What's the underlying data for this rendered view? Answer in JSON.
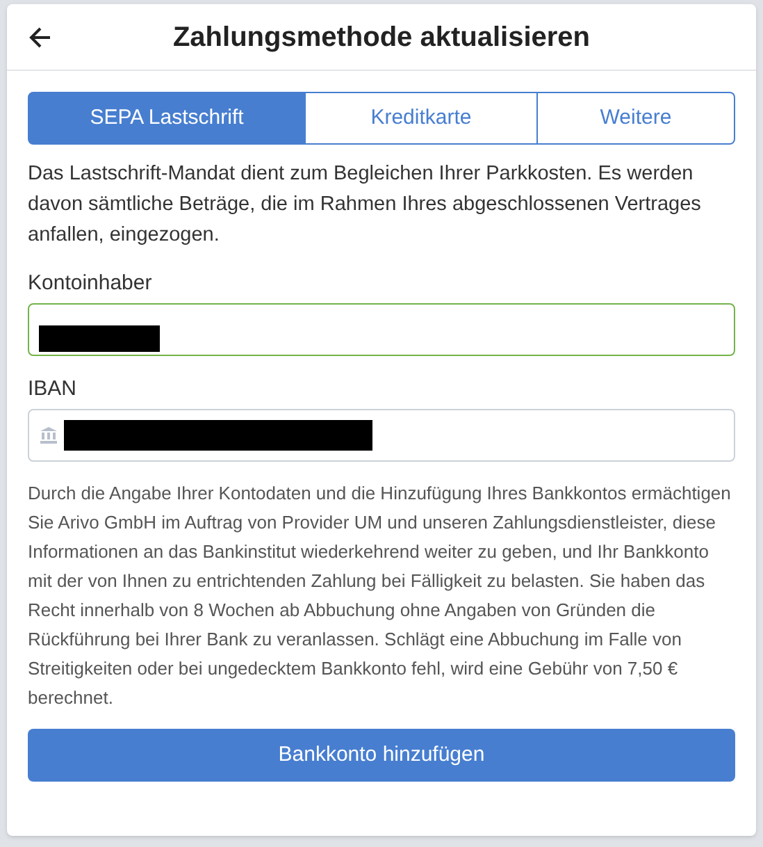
{
  "header": {
    "title": "Zahlungsmethode aktualisieren"
  },
  "tabs": [
    {
      "label": "SEPA Lastschrift",
      "selected": true
    },
    {
      "label": "Kreditkarte",
      "selected": false
    },
    {
      "label": "Weitere",
      "selected": false
    }
  ],
  "intro": "Das Lastschrift-Mandat dient zum Begleichen Ihrer Parkkosten. Es werden davon sämtliche Beträge, die im Rahmen Ihres abgeschlossenen Vertrages anfallen, eingezogen.",
  "fields": [
    {
      "label": "Kontoinhaber",
      "kind": "text",
      "valid": true,
      "redacted": true
    },
    {
      "label": "IBAN",
      "kind": "bank",
      "valid": false,
      "redacted": true
    }
  ],
  "disclaimer": "Durch die Angabe Ihrer Kontodaten und die Hinzufügung Ihres Bankkontos ermächtigen Sie Arivo GmbH im Auftrag von Provider UM und unseren Zahlungsdienstleister, diese Informationen an das Bankinstitut wiederkehrend weiter zu geben, und Ihr Bankkonto mit der von Ihnen zu entrichtenden Zahlung bei Fälligkeit zu belasten. Sie haben das Recht innerhalb von 8 Wochen ab Abbuchung ohne Angaben von Gründen die Rückführung bei Ihrer Bank zu veranlassen. Schlägt eine Abbuchung im Falle von Streitigkeiten oder bei ungedecktem Bankkonto fehl, wird eine Gebühr von 7,50 € berechnet.",
  "submit": {
    "label": "Bankkonto hinzufügen"
  }
}
